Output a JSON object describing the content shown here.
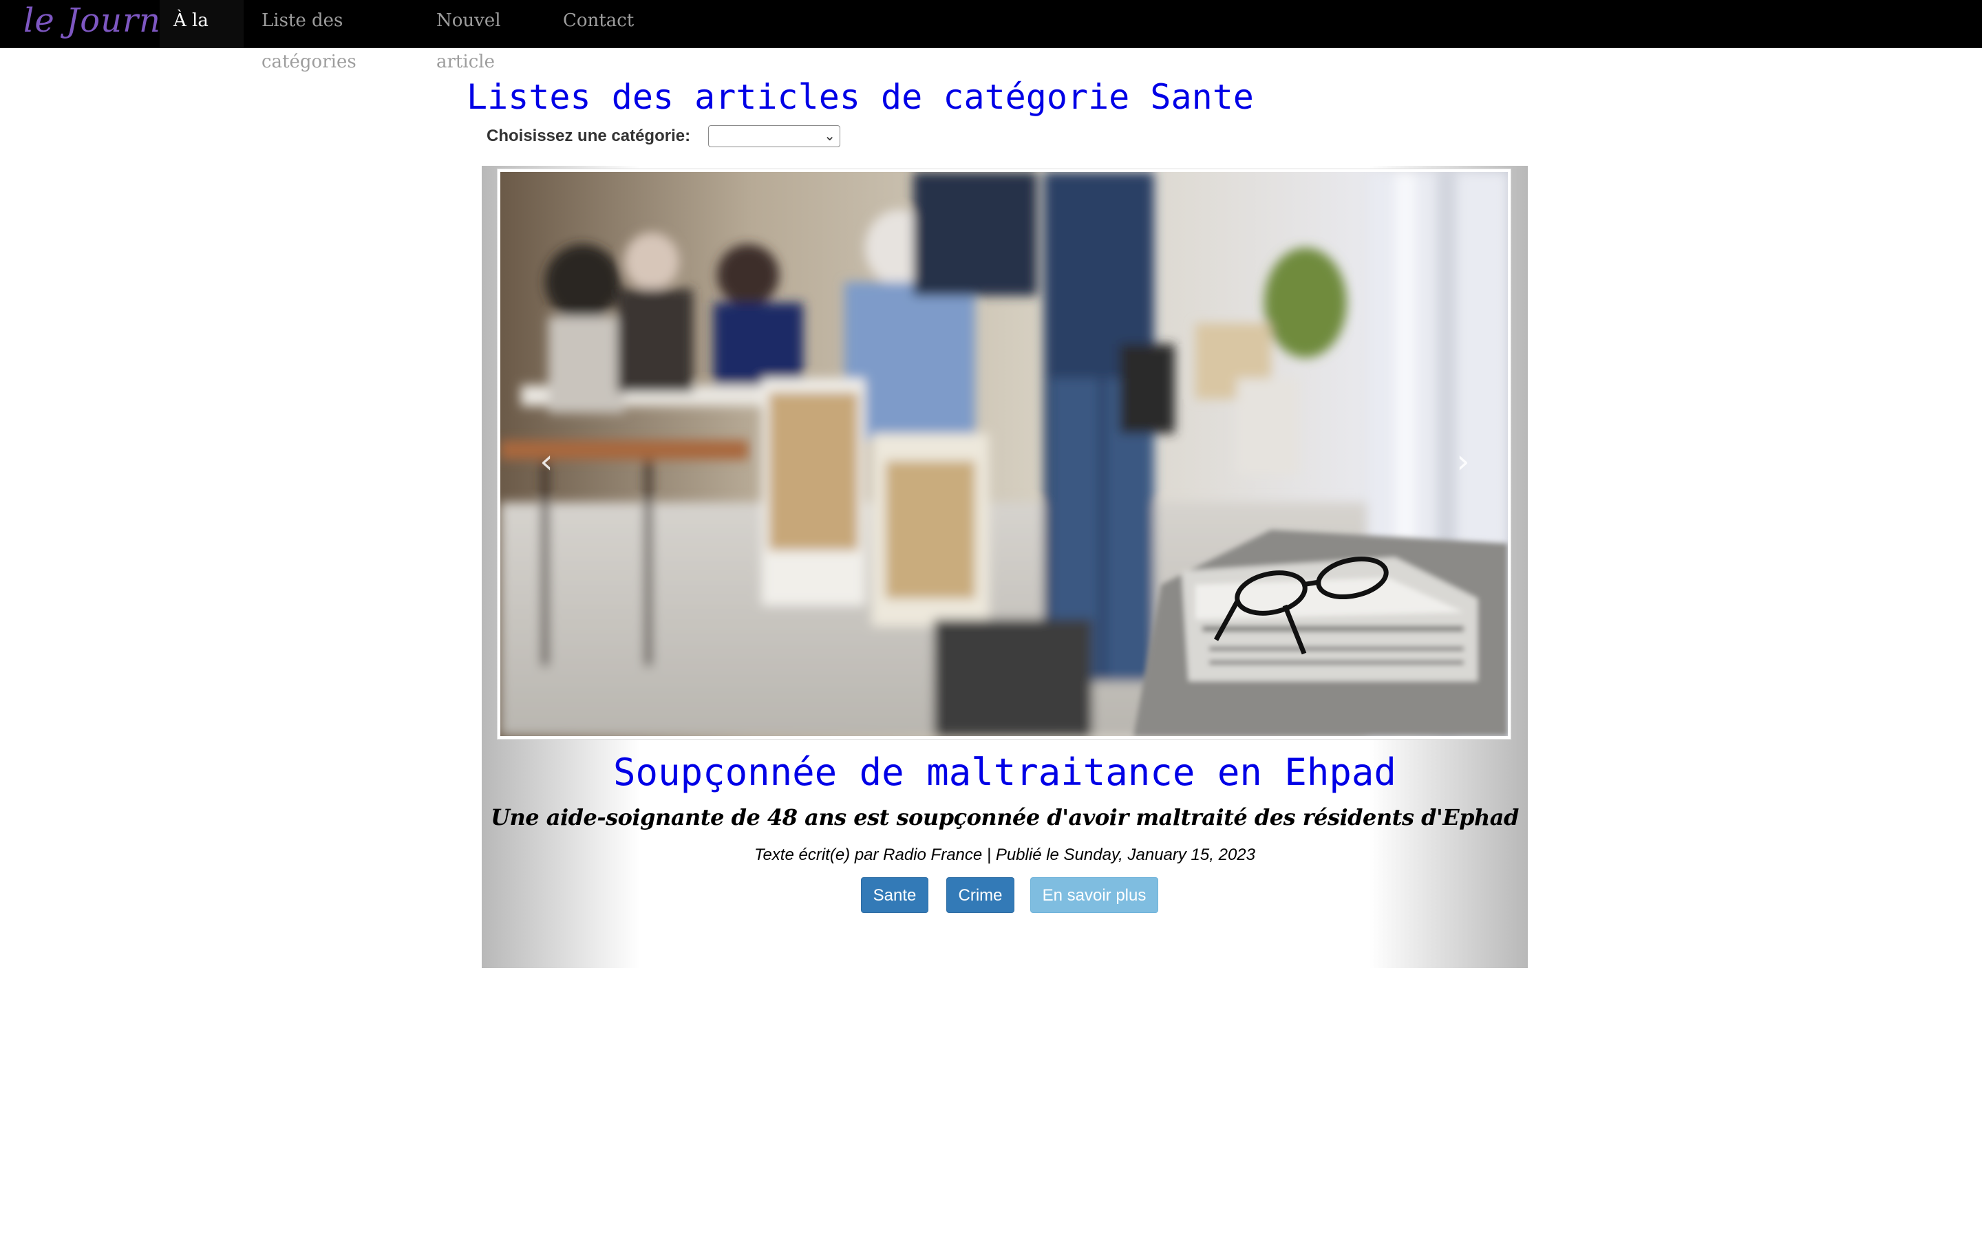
{
  "navbar": {
    "brand": "le Journal",
    "items": [
      {
        "label": "À la une",
        "active": true
      },
      {
        "label": "Liste des catégories",
        "active": false
      },
      {
        "label": "Nouvel article",
        "active": false
      },
      {
        "label": "Contact",
        "active": false
      }
    ]
  },
  "list": {
    "title": "Listes des articles de catégorie Sante",
    "choose_label": "Choisissez une catégorie:",
    "selected_category": ""
  },
  "carousel": {
    "prev_icon": "chevron-left-icon",
    "next_icon": "chevron-right-icon",
    "article": {
      "title": "Soupçonnée de maltraitance en Ehpad",
      "subtitle": "Une aide-soignante de 48 ans est soupçonnée d'avoir maltraité des résidents d'Ephad",
      "meta": "Texte écrit(e) par Radio France | Publié le Sunday, January 15, 2023",
      "buttons": {
        "category1": "Sante",
        "category2": "Crime",
        "more": "En savoir plus"
      }
    }
  },
  "colors": {
    "navbar_bg": "#000000",
    "brand": "#7e57c2",
    "title_blue": "#0000e6",
    "btn_primary": "#337ab7",
    "btn_info": "#7fbde0"
  }
}
